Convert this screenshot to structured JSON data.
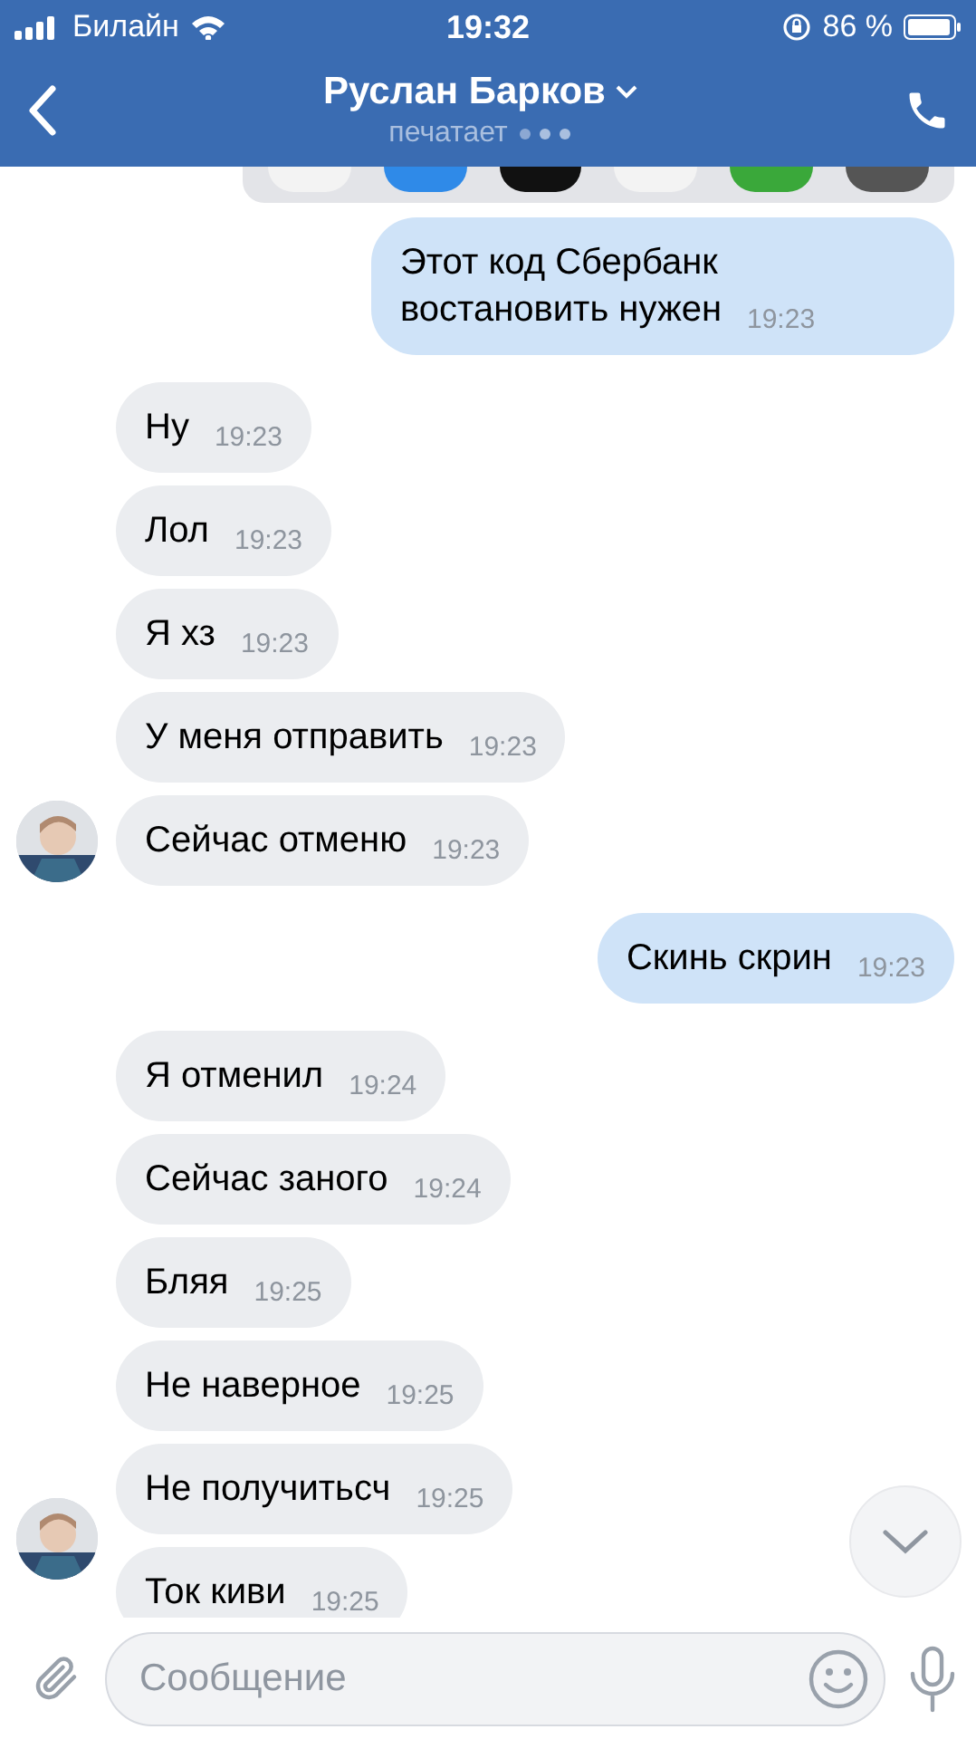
{
  "status_bar": {
    "carrier": "Билайн",
    "time": "19:32",
    "battery": "86 %"
  },
  "header": {
    "title": "Руслан Барков",
    "status": "печатает"
  },
  "messages": [
    {
      "kind": "outgoing",
      "text": "Этот код Сбербанк востановить нужен",
      "time": "19:23"
    },
    {
      "kind": "incoming",
      "text": "Ну",
      "time": "19:23",
      "avatar": false
    },
    {
      "kind": "incoming",
      "text": "Лол",
      "time": "19:23",
      "avatar": false
    },
    {
      "kind": "incoming",
      "text": "Я хз",
      "time": "19:23",
      "avatar": false
    },
    {
      "kind": "incoming",
      "text": "У меня отправить",
      "time": "19:23",
      "avatar": false
    },
    {
      "kind": "incoming",
      "text": "Сейчас отменю",
      "time": "19:23",
      "avatar": true
    },
    {
      "kind": "outgoing",
      "text": "Скинь скрин",
      "time": "19:23"
    },
    {
      "kind": "incoming",
      "text": "Я отменил",
      "time": "19:24",
      "avatar": false
    },
    {
      "kind": "incoming",
      "text": "Сейчас заного",
      "time": "19:24",
      "avatar": false
    },
    {
      "kind": "incoming",
      "text": "Бляя",
      "time": "19:25",
      "avatar": false
    },
    {
      "kind": "incoming",
      "text": "Не наверное",
      "time": "19:25",
      "avatar": false
    },
    {
      "kind": "incoming",
      "text": "Не получитьсч",
      "time": "19:25",
      "avatar": false
    },
    {
      "kind": "incoming",
      "text": "Ток киви",
      "time": "19:25",
      "avatar": true
    }
  ],
  "composer": {
    "placeholder": "Сообщение"
  }
}
